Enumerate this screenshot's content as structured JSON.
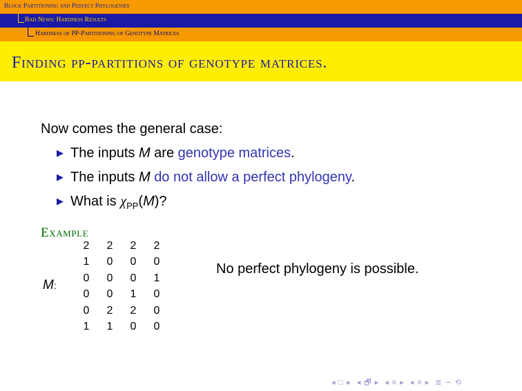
{
  "headline": {
    "section": "Block Partitioning and Perfect Phylogenies",
    "subsection": "Bad News: Hardness Results",
    "subsubsection": "Hardness of PP-Partitioning of Genotype Matrices"
  },
  "frame_title": "Finding pp-partitions of genotype matrices.",
  "intro": "Now comes the general case:",
  "bullets": [
    {
      "pre": "The inputs ",
      "var": "M",
      "mid": " are ",
      "highlight": "genotype matrices",
      "post": "."
    },
    {
      "pre": "The inputs ",
      "var": "M",
      "mid": " ",
      "highlight": "do not allow a perfect phylogeny",
      "post": "."
    },
    {
      "pre": "What is ",
      "chi": "χ",
      "sub": "PP",
      "arg_open": "(",
      "var": "M",
      "arg_close": ")?"
    }
  ],
  "example": {
    "heading": "Example",
    "label_var": "M",
    "label_colon": ":",
    "matrix": [
      [
        "2",
        "2",
        "2",
        "2"
      ],
      [
        "1",
        "0",
        "0",
        "0"
      ],
      [
        "0",
        "0",
        "0",
        "1"
      ],
      [
        "0",
        "0",
        "1",
        "0"
      ],
      [
        "0",
        "2",
        "2",
        "0"
      ],
      [
        "1",
        "1",
        "0",
        "0"
      ]
    ],
    "note": "No perfect phylogeny is possible."
  },
  "nav_icons": [
    "◂",
    "□",
    "▸",
    "◂",
    "🗗",
    "▸",
    "◂",
    "≡",
    "▸",
    "◂",
    "≡",
    "▸",
    "≣",
    "∽",
    "⟲"
  ],
  "colors": {
    "accent": "#1a1aa6",
    "highlight": "#3333b3",
    "headline_orange": "#f79a00",
    "title_yellow": "#ffee00",
    "example_green": "#006b00"
  }
}
